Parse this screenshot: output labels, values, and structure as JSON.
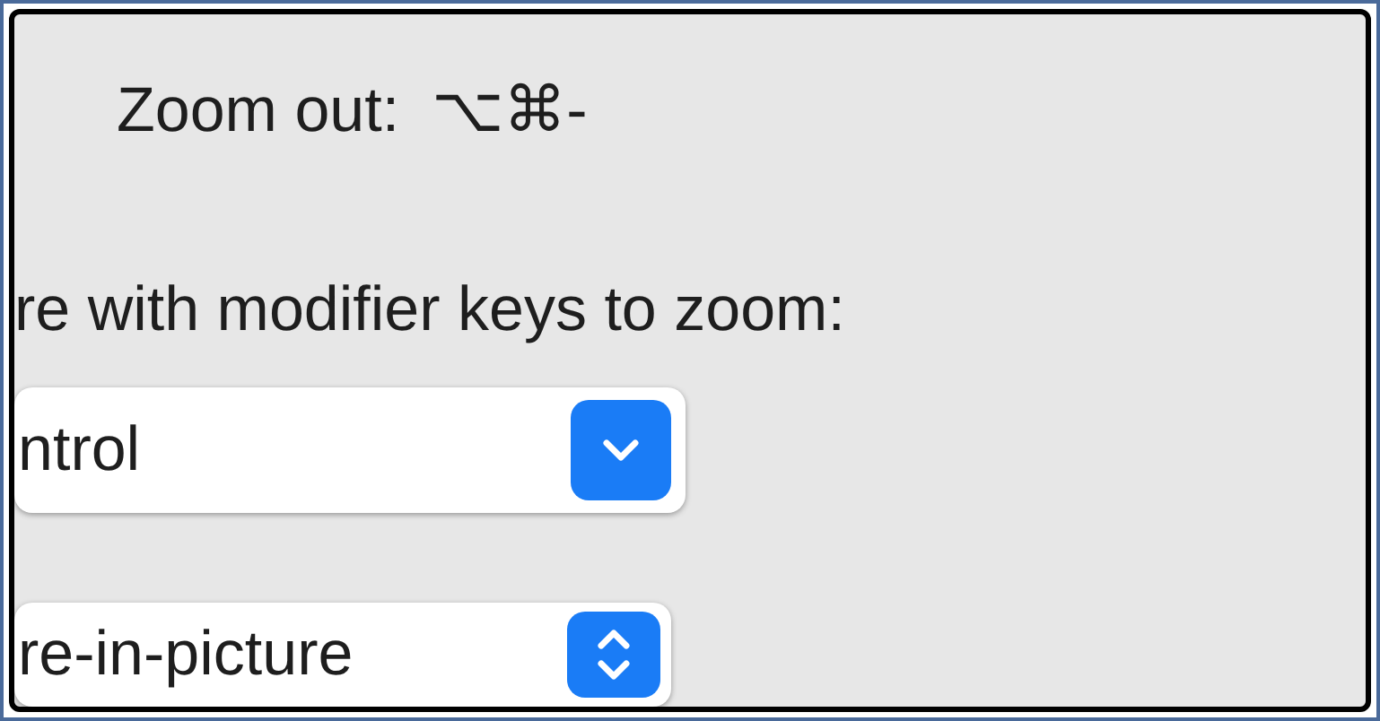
{
  "zoom_out": {
    "label": "Zoom out:",
    "shortcut": "⌥⌘-"
  },
  "modifier_label": "re with modifier keys to zoom:",
  "dropdowns": [
    {
      "kind": "pulldown",
      "value": "ntrol"
    },
    {
      "kind": "popup",
      "value": "re-in-picture"
    }
  ]
}
